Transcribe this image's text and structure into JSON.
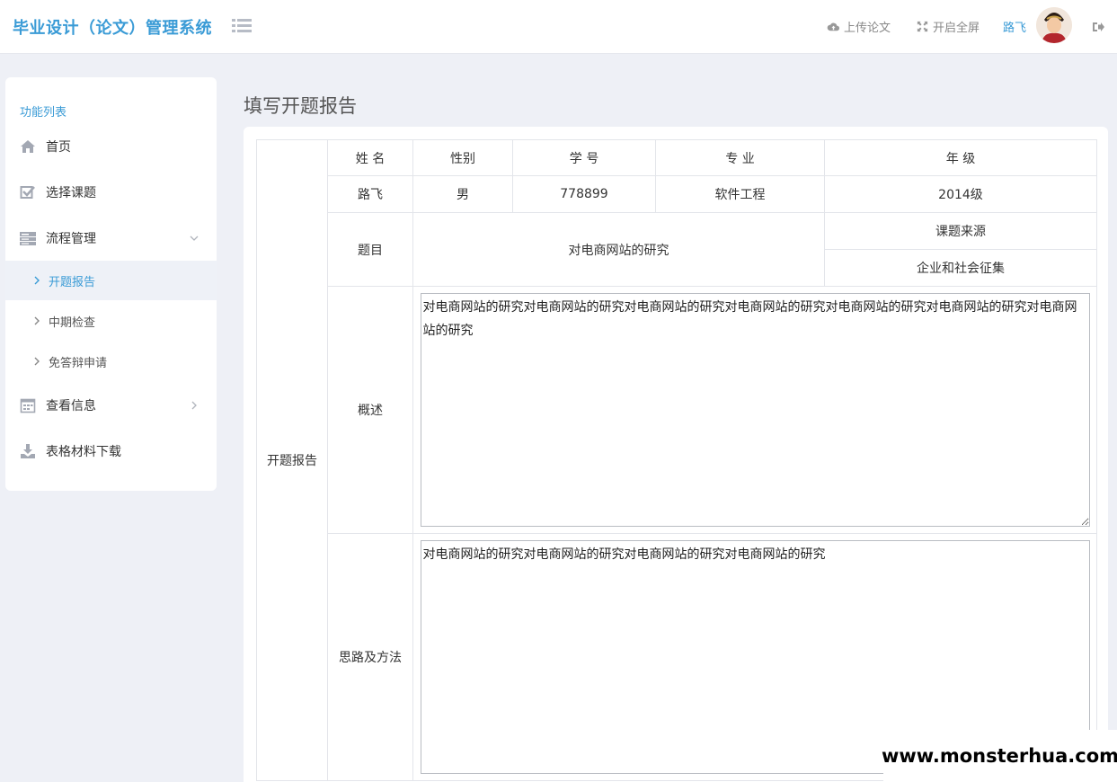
{
  "header": {
    "app_title": "毕业设计（论文）管理系统",
    "upload_label": "上传论文",
    "fullscreen_label": "开启全屏",
    "username": "路飞"
  },
  "sidebar": {
    "heading": "功能列表",
    "items": [
      {
        "label": "首页",
        "icon": "home-icon"
      },
      {
        "label": "选择课题",
        "icon": "checkbox-icon"
      },
      {
        "label": "流程管理",
        "icon": "server-icon"
      },
      {
        "label": "查看信息",
        "icon": "calendar-icon"
      },
      {
        "label": "表格材料下载",
        "icon": "download-icon"
      }
    ],
    "sub_items": [
      {
        "label": "开题报告",
        "active": true
      },
      {
        "label": "中期检查"
      },
      {
        "label": "免答辩申请"
      }
    ]
  },
  "main": {
    "page_title": "填写开题报告",
    "section_label": "开题报告",
    "headers": {
      "name": "姓 名",
      "gender": "性别",
      "student_id": "学 号",
      "major": "专 业",
      "grade": "年 级"
    },
    "student": {
      "name": "路飞",
      "gender": "男",
      "student_id": "778899",
      "major": "软件工程",
      "grade": "2014级"
    },
    "topic_label": "题目",
    "topic_value": "对电商网站的研究",
    "source_label": "课题来源",
    "source_value": "企业和社会征集",
    "summary_label": "概述",
    "summary_text": "对电商网站的研究对电商网站的研究对电商网站的研究对电商网站的研究对电商网站的研究对电商网站的研究对电商网站的研究",
    "method_label": "思路及方法",
    "method_text": "对电商网站的研究对电商网站的研究对电商网站的研究对电商网站的研究"
  },
  "watermark": "www.monsterhua.com"
}
